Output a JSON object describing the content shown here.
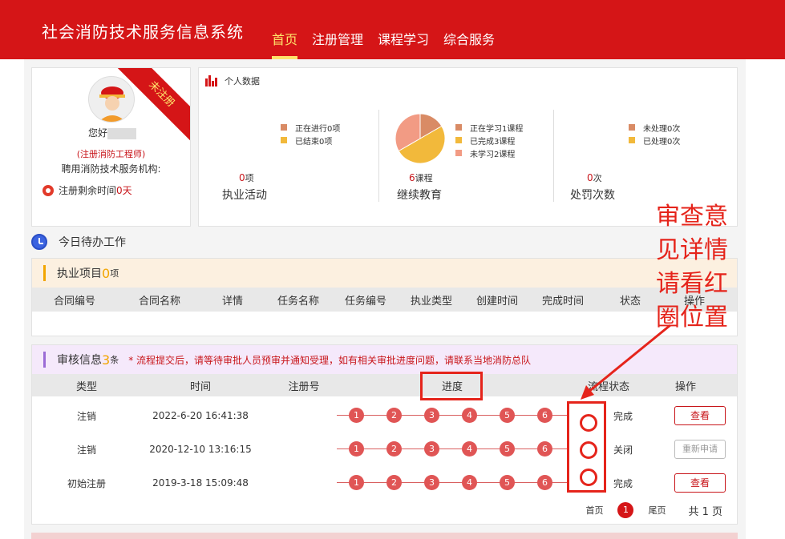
{
  "app": {
    "title": "社会消防技术服务信息系统"
  },
  "nav": [
    {
      "label": "首页",
      "active": true
    },
    {
      "label": "注册管理"
    },
    {
      "label": "课程学习"
    },
    {
      "label": "综合服务"
    }
  ],
  "profile": {
    "ribbon": "未注册",
    "greeting": "您好",
    "role": "(注册消防工程师)",
    "org_label": "聘用消防技术服务机构:",
    "remaining_label": "注册剩余时间",
    "remaining_value": "0天"
  },
  "stats": {
    "heading": "个人数据",
    "blocks": [
      {
        "num": "0",
        "unit": "项",
        "label": "执业活动",
        "legend": [
          {
            "text": "正在进行0项",
            "color": "#d98b65"
          },
          {
            "text": "已结束0项",
            "color": "#f2b93b"
          }
        ]
      },
      {
        "num": "6",
        "unit": "课程",
        "label": "继续教育",
        "legend": [
          {
            "text": "正在学习1课程",
            "color": "#d98b65"
          },
          {
            "text": "已完成3课程",
            "color": "#f2b93b"
          },
          {
            "text": "未学习2课程",
            "color": "#f29b84"
          }
        ],
        "pie": [
          {
            "value": 1,
            "color": "#d98b65"
          },
          {
            "value": 3,
            "color": "#f2b93b"
          },
          {
            "value": 2,
            "color": "#f29b84"
          }
        ]
      },
      {
        "num": "0",
        "unit": "次",
        "label": "处罚次数",
        "legend": [
          {
            "text": "未处理0次",
            "color": "#d98b65"
          },
          {
            "text": "已处理0次",
            "color": "#f2b93b"
          }
        ]
      }
    ]
  },
  "todo": {
    "title": "今日待办工作"
  },
  "exec": {
    "title": "执业项目",
    "count": "0",
    "unit": "项",
    "columns": [
      "合同编号",
      "合同名称",
      "详情",
      "任务名称",
      "任务编号",
      "执业类型",
      "创建时间",
      "完成时间",
      "状态",
      "操作"
    ]
  },
  "audit": {
    "title": "审核信息",
    "count": "3",
    "unit": "条",
    "notice": "* 流程提交后，请等待审批人员预审并通知受理，如有相关审批进度问题，请联系当地消防总队",
    "columns": [
      "类型",
      "时间",
      "注册号",
      "进度",
      "流程状态",
      "操作"
    ],
    "steps": [
      "1",
      "2",
      "3",
      "4",
      "5",
      "6"
    ],
    "rows": [
      {
        "type": "注销",
        "time": "2022-6-20 16:41:38",
        "reg_no": "",
        "status": "完成",
        "action": "查看"
      },
      {
        "type": "注销",
        "time": "2020-12-10 13:16:15",
        "reg_no": "",
        "status": "关闭",
        "action": "重新申请"
      },
      {
        "type": "初始注册",
        "time": "2019-3-18 15:09:48",
        "reg_no": "",
        "status": "完成",
        "action": "查看"
      }
    ]
  },
  "pager": {
    "first": "首页",
    "current": "1",
    "last": "尾页",
    "total": "共 1 页"
  },
  "annotation": {
    "text": "审查意见详情请看红圈位置",
    "color": "#e5241b"
  }
}
